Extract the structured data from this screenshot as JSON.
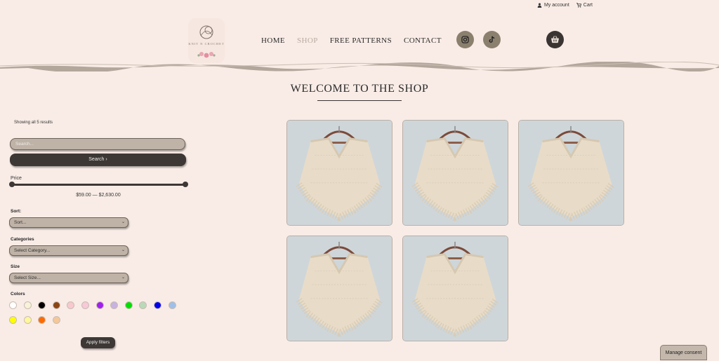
{
  "topbar": {
    "account_label": "My account",
    "cart_label": "Cart"
  },
  "logo": {
    "wordmark": "KNIT N CROCHET"
  },
  "nav": [
    {
      "label": "HOME",
      "active": false
    },
    {
      "label": "SHOP",
      "active": true
    },
    {
      "label": "FREE PATTERNS",
      "active": false
    },
    {
      "label": "CONTACT",
      "active": false
    }
  ],
  "social": [
    {
      "icon": "instagram-icon"
    },
    {
      "icon": "tiktok-icon"
    }
  ],
  "basket_icon": "basket-icon",
  "page": {
    "title": "WELCOME TO THE SHOP"
  },
  "sidebar": {
    "results_text": "Showing all 5 results",
    "search_placeholder": "Search...",
    "search_button": "Search ›",
    "price_label": "Price",
    "price_range": "$59.00 — $2,630.00",
    "sort_label": "Sort:",
    "sort_value": "Sort...",
    "categories_label": "Categories",
    "categories_value": "Select Category...",
    "size_label": "Size",
    "size_value": "Select Size...",
    "colors_label": "Colors",
    "colors": [
      "#ffffff",
      "#f7f2d8",
      "#000000",
      "#8b4513",
      "#f7c9cf",
      "#f7c9d9",
      "#a020f0",
      "#c7b2e0",
      "#00e000",
      "#b9dab9",
      "#0000ee",
      "#9fbfe8",
      "#ffff00",
      "#fff79a",
      "#ff6a00",
      "#f5c89a"
    ],
    "apply_button": "Apply filters"
  },
  "products": [
    {
      "image": "crochet-poncho"
    },
    {
      "image": "crochet-poncho"
    },
    {
      "image": "crochet-poncho"
    },
    {
      "image": "crochet-poncho"
    },
    {
      "image": "crochet-poncho"
    }
  ],
  "consent": {
    "label": "Manage consent"
  },
  "colors": {
    "background": "#f9ece6",
    "dark": "#3d3835",
    "taupe": "#8b7f6e"
  }
}
